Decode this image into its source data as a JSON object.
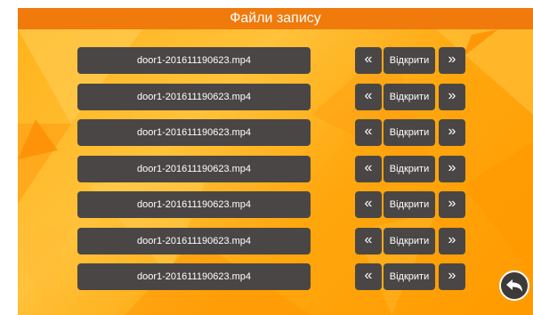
{
  "header": {
    "title": "Файли запису"
  },
  "files": [
    {
      "name": "door1-201611190623.mp4",
      "open_label": "Відкрити"
    },
    {
      "name": "door1-201611190623.mp4",
      "open_label": "Відкрити"
    },
    {
      "name": "door1-201611190623.mp4",
      "open_label": "Відкрити"
    },
    {
      "name": "door1-201611190623.mp4",
      "open_label": "Відкрити"
    },
    {
      "name": "door1-201611190623.mp4",
      "open_label": "Відкрити"
    },
    {
      "name": "door1-201611190623.mp4",
      "open_label": "Відкрити"
    },
    {
      "name": "door1-201611190623.mp4",
      "open_label": "Відкрити"
    }
  ],
  "icons": {
    "prev": "double-chevron-left-icon",
    "next": "double-chevron-right-icon",
    "back": "return-arrow-icon"
  },
  "colors": {
    "title_bar": "#f07a0c",
    "button": "#4a4646",
    "background": "#ffb21a"
  }
}
